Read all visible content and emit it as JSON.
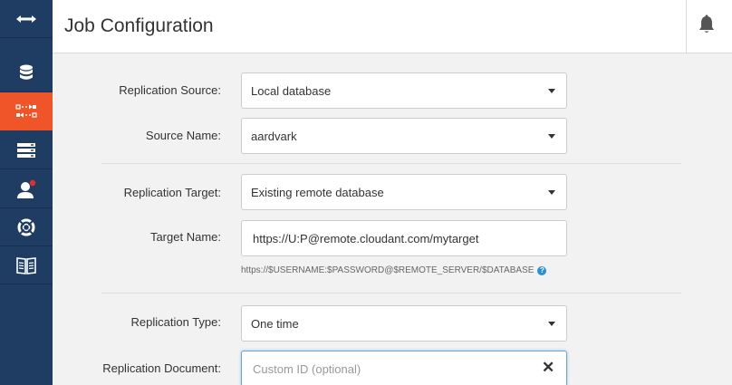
{
  "header": {
    "title": "Job Configuration"
  },
  "sidebar": {
    "items": [
      {
        "icon": "expand-arrows-icon"
      },
      {
        "icon": "database-icon"
      },
      {
        "icon": "replication-icon",
        "active": true
      },
      {
        "icon": "server-stack-icon"
      },
      {
        "icon": "user-icon",
        "badge": true
      },
      {
        "icon": "lifebuoy-icon"
      },
      {
        "icon": "book-icon"
      }
    ]
  },
  "form": {
    "source": {
      "label": "Replication Source:",
      "value": "Local database"
    },
    "source_name": {
      "label": "Source Name:",
      "value": "aardvark"
    },
    "target": {
      "label": "Replication Target:",
      "value": "Existing remote database"
    },
    "target_name": {
      "label": "Target Name:",
      "value": "https://U:P@remote.cloudant.com/mytarget",
      "help": "https://$USERNAME:$PASSWORD@$REMOTE_SERVER/$DATABASE",
      "help_icon": "?"
    },
    "type": {
      "label": "Replication Type:",
      "value": "One time"
    },
    "document": {
      "label": "Replication Document:",
      "value": "",
      "placeholder": "Custom ID (optional)",
      "clear_glyph": "✕"
    }
  },
  "colors": {
    "sidebar_bg": "#1f3d63",
    "active_item": "#f0552a",
    "badge": "#e0302e",
    "help_icon": "#2b8fd6"
  }
}
